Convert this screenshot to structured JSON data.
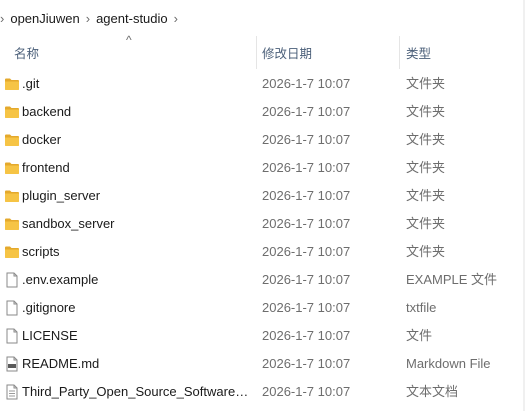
{
  "breadcrumb": {
    "items": [
      "openJiuwen",
      "agent-studio"
    ]
  },
  "columns": {
    "name": "名称",
    "modified": "修改日期",
    "type": "类型"
  },
  "sort": {
    "column": "name",
    "direction": "ascending"
  },
  "files": [
    {
      "icon": "folder-icon",
      "name": ".git",
      "modified": "2026-1-7 10:07",
      "type": "文件夹"
    },
    {
      "icon": "folder-icon",
      "name": "backend",
      "modified": "2026-1-7 10:07",
      "type": "文件夹"
    },
    {
      "icon": "folder-icon",
      "name": "docker",
      "modified": "2026-1-7 10:07",
      "type": "文件夹"
    },
    {
      "icon": "folder-icon",
      "name": "frontend",
      "modified": "2026-1-7 10:07",
      "type": "文件夹"
    },
    {
      "icon": "folder-icon",
      "name": "plugin_server",
      "modified": "2026-1-7 10:07",
      "type": "文件夹"
    },
    {
      "icon": "folder-icon",
      "name": "sandbox_server",
      "modified": "2026-1-7 10:07",
      "type": "文件夹"
    },
    {
      "icon": "folder-icon",
      "name": "scripts",
      "modified": "2026-1-7 10:07",
      "type": "文件夹"
    },
    {
      "icon": "file-icon",
      "name": ".env.example",
      "modified": "2026-1-7 10:07",
      "type": "EXAMPLE 文件"
    },
    {
      "icon": "file-icon",
      "name": ".gitignore",
      "modified": "2026-1-7 10:07",
      "type": "txtfile"
    },
    {
      "icon": "file-icon",
      "name": "LICENSE",
      "modified": "2026-1-7 10:07",
      "type": "文件"
    },
    {
      "icon": "markdown-file-icon",
      "name": "README.md",
      "modified": "2026-1-7 10:07",
      "type": "Markdown File"
    },
    {
      "icon": "text-document-icon",
      "name": "Third_Party_Open_Source_Software_N...",
      "modified": "2026-1-7 10:07",
      "type": "文本文档"
    }
  ],
  "colors": {
    "folder": "#f6c445",
    "folder_dark": "#e4a92c",
    "header_text": "#4c607a",
    "secondary_text": "#6d6d6d"
  }
}
